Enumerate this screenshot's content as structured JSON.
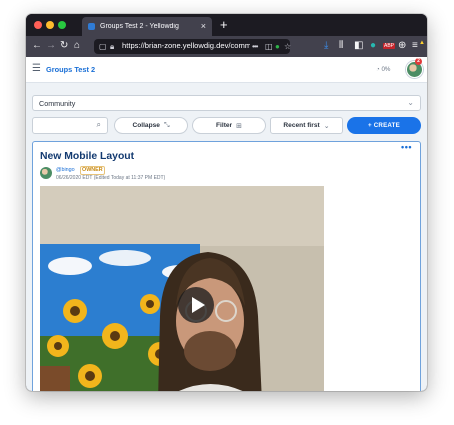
{
  "browser": {
    "tab_title": "Groups Test 2 - Yellowdig",
    "tab_close": "×",
    "new_tab": "+",
    "url": "https://brian-zone.yellowdig.dev/community",
    "url_more": "•••",
    "extension_badge": "ABP",
    "traffic_lights": {
      "close": "#ff5f57",
      "minimize": "#febc2e",
      "maximize": "#28c840"
    }
  },
  "header": {
    "menu_icon": "hamburger-icon",
    "group_title": "Groups Test 2",
    "progress_text": "0%",
    "notification_count": "2"
  },
  "community_select": {
    "value": "Community"
  },
  "toolbar": {
    "search_placeholder": "",
    "collapse_label": "Collapse",
    "filter_label": "Filter",
    "sort_label": "Recent first",
    "create_label": "+ CREATE"
  },
  "post": {
    "title": "New Mobile Layout",
    "author": "@bingo",
    "role_badge": "OWNER",
    "meta": "06/26/2020 EDT  (Edited Today at 11:37 PM EDT)",
    "more": "•••"
  },
  "colors": {
    "accent": "#1a73e8",
    "title": "#133a70",
    "owner_badge": "#c98a12",
    "page_bg": "#eef2f6"
  }
}
